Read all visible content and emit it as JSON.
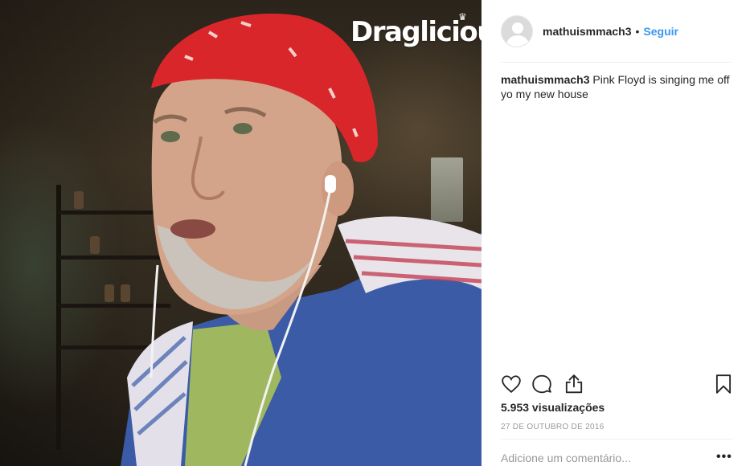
{
  "media": {
    "watermark": "Draglicious",
    "colors": {
      "bandana": "#d8262b",
      "hoodie": "#3b5ba6"
    }
  },
  "post": {
    "username": "mathuismmach3",
    "separator": "•",
    "follow_label": "Seguir",
    "caption_user": "mathuismmach3",
    "caption_text": " Pink Floyd is singing me off yo my new house",
    "views": "5.953 visualizações",
    "date": "27 DE OUTUBRO DE 2016",
    "comment_placeholder": "Adicione um comentário...",
    "more_label": "•••"
  },
  "icons": {
    "like": "heart-icon",
    "comment": "comment-icon",
    "share": "share-icon",
    "save": "bookmark-icon"
  },
  "colors": {
    "link": "#3897f0",
    "text": "#262626",
    "muted": "#999999"
  }
}
